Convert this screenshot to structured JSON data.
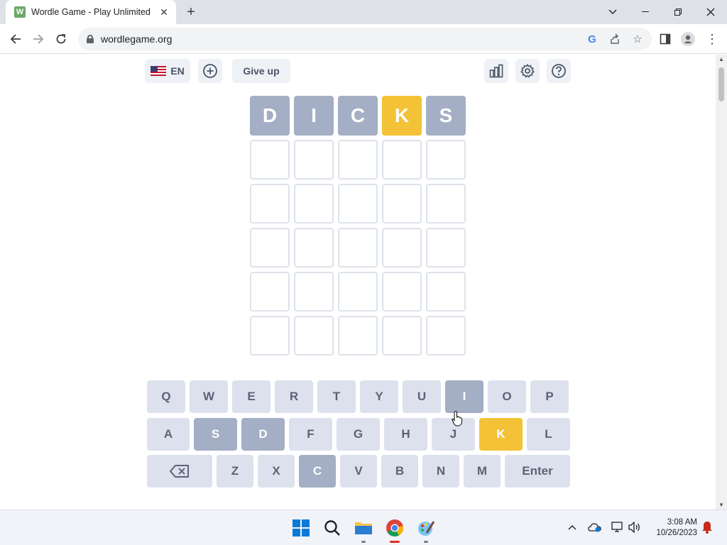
{
  "browser": {
    "tab_title": "Wordle Game - Play Unlimited",
    "favicon_letter": "W",
    "url": "wordlegame.org"
  },
  "header": {
    "language": "EN",
    "give_up_label": "Give up"
  },
  "grid": {
    "rows": [
      [
        {
          "letter": "D",
          "state": "absent"
        },
        {
          "letter": "I",
          "state": "absent"
        },
        {
          "letter": "C",
          "state": "absent"
        },
        {
          "letter": "K",
          "state": "present"
        },
        {
          "letter": "S",
          "state": "absent"
        }
      ],
      [
        {
          "letter": "",
          "state": "empty"
        },
        {
          "letter": "",
          "state": "empty"
        },
        {
          "letter": "",
          "state": "empty"
        },
        {
          "letter": "",
          "state": "empty"
        },
        {
          "letter": "",
          "state": "empty"
        }
      ],
      [
        {
          "letter": "",
          "state": "empty"
        },
        {
          "letter": "",
          "state": "empty"
        },
        {
          "letter": "",
          "state": "empty"
        },
        {
          "letter": "",
          "state": "empty"
        },
        {
          "letter": "",
          "state": "empty"
        }
      ],
      [
        {
          "letter": "",
          "state": "empty"
        },
        {
          "letter": "",
          "state": "empty"
        },
        {
          "letter": "",
          "state": "empty"
        },
        {
          "letter": "",
          "state": "empty"
        },
        {
          "letter": "",
          "state": "empty"
        }
      ],
      [
        {
          "letter": "",
          "state": "empty"
        },
        {
          "letter": "",
          "state": "empty"
        },
        {
          "letter": "",
          "state": "empty"
        },
        {
          "letter": "",
          "state": "empty"
        },
        {
          "letter": "",
          "state": "empty"
        }
      ],
      [
        {
          "letter": "",
          "state": "empty"
        },
        {
          "letter": "",
          "state": "empty"
        },
        {
          "letter": "",
          "state": "empty"
        },
        {
          "letter": "",
          "state": "empty"
        },
        {
          "letter": "",
          "state": "empty"
        }
      ]
    ]
  },
  "keyboard": {
    "rows": [
      [
        {
          "label": "Q",
          "state": ""
        },
        {
          "label": "W",
          "state": ""
        },
        {
          "label": "E",
          "state": ""
        },
        {
          "label": "R",
          "state": ""
        },
        {
          "label": "T",
          "state": ""
        },
        {
          "label": "Y",
          "state": ""
        },
        {
          "label": "U",
          "state": ""
        },
        {
          "label": "I",
          "state": "absent"
        },
        {
          "label": "O",
          "state": ""
        },
        {
          "label": "P",
          "state": ""
        }
      ],
      [
        {
          "label": "A",
          "state": ""
        },
        {
          "label": "S",
          "state": "absent"
        },
        {
          "label": "D",
          "state": "absent"
        },
        {
          "label": "F",
          "state": ""
        },
        {
          "label": "G",
          "state": ""
        },
        {
          "label": "H",
          "state": ""
        },
        {
          "label": "J",
          "state": ""
        },
        {
          "label": "K",
          "state": "present"
        },
        {
          "label": "L",
          "state": ""
        }
      ],
      [
        {
          "label": "",
          "state": "",
          "icon": "backspace-icon"
        },
        {
          "label": "Z",
          "state": ""
        },
        {
          "label": "X",
          "state": ""
        },
        {
          "label": "C",
          "state": "absent"
        },
        {
          "label": "V",
          "state": ""
        },
        {
          "label": "B",
          "state": ""
        },
        {
          "label": "N",
          "state": ""
        },
        {
          "label": "M",
          "state": ""
        },
        {
          "label": "Enter",
          "state": ""
        }
      ]
    ]
  },
  "colors": {
    "absent": "#a4aec4",
    "present": "#f3c237",
    "correct": "#79b851",
    "key_default": "#dce1ed"
  },
  "taskbar": {
    "time": "3:08 AM",
    "date": "10/26/2023"
  }
}
